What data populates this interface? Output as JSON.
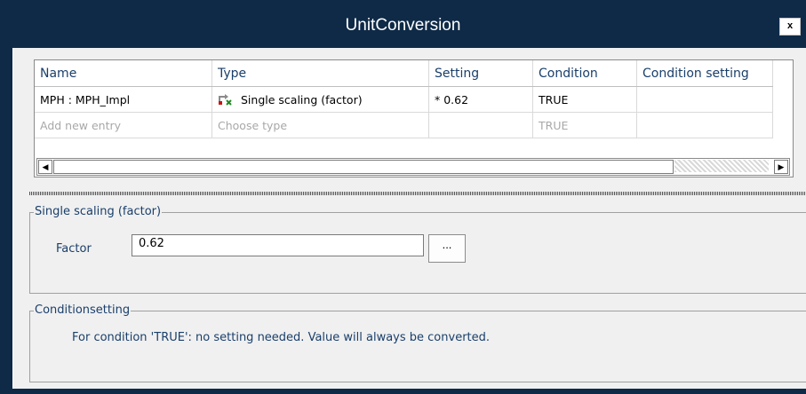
{
  "window": {
    "title": "UnitConversion",
    "close_label": "x"
  },
  "grid": {
    "columns": [
      "Name",
      "Type",
      "Setting",
      "Condition",
      "Condition setting"
    ],
    "rows": [
      {
        "name": "MPH : MPH_Impl",
        "type": "Single scaling (factor)",
        "type_icon": "scaling-factor-icon",
        "setting": "* 0.62",
        "condition": "TRUE",
        "condition_setting": ""
      }
    ],
    "new_row": {
      "name": "Add new entry",
      "type": "Choose type",
      "setting": "",
      "condition": "TRUE",
      "condition_setting": ""
    },
    "scrollbar": {
      "left_arrow": "◀",
      "right_arrow": "▶"
    }
  },
  "scaling_group": {
    "title": "Single scaling (factor)",
    "factor_label": "Factor",
    "factor_value": "0.62",
    "browse_label": "..."
  },
  "condition_group": {
    "title": "Conditionsetting",
    "message": "For condition 'TRUE': no setting needed. Value will always be converted."
  },
  "colors": {
    "titlebar": "#0e2a47",
    "client": "#f0f0f0",
    "label_text": "#1a3f6b",
    "placeholder": "#a8a8a8"
  }
}
